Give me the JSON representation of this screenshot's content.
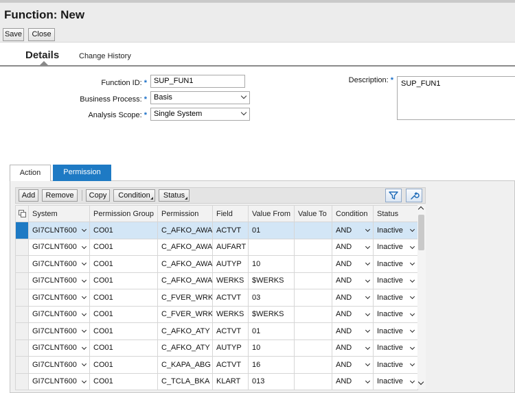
{
  "header": {
    "title": "Function: New",
    "save_label": "Save",
    "close_label": "Close"
  },
  "tabs": {
    "details": "Details",
    "change_history": "Change History"
  },
  "form": {
    "function_id_label": "Function ID:",
    "function_id_value": "SUP_FUN1",
    "business_process_label": "Business Process:",
    "business_process_value": "Basis",
    "analysis_scope_label": "Analysis Scope:",
    "analysis_scope_value": "Single System",
    "description_label": "Description:",
    "description_value": "SUP_FUN1",
    "required_marker": "*"
  },
  "subtabs": {
    "action": "Action",
    "permission": "Permission"
  },
  "toolbar": {
    "add": "Add",
    "remove": "Remove",
    "copy": "Copy",
    "condition": "Condition",
    "status": "Status"
  },
  "table": {
    "columns": [
      "System",
      "Permission Group",
      "Permission",
      "Field",
      "Value From",
      "Value To",
      "Condition",
      "Status"
    ],
    "rows": [
      [
        "GI7CLNT600",
        "CO01",
        "C_AFKO_AWA",
        "ACTVT",
        "01",
        "",
        "AND",
        "Inactive"
      ],
      [
        "GI7CLNT600",
        "CO01",
        "C_AFKO_AWA",
        "AUFART",
        "",
        "",
        "AND",
        "Inactive"
      ],
      [
        "GI7CLNT600",
        "CO01",
        "C_AFKO_AWA",
        "AUTYP",
        "10",
        "",
        "AND",
        "Inactive"
      ],
      [
        "GI7CLNT600",
        "CO01",
        "C_AFKO_AWA",
        "WERKS",
        "$WERKS",
        "",
        "AND",
        "Inactive"
      ],
      [
        "GI7CLNT600",
        "CO01",
        "C_FVER_WRK",
        "ACTVT",
        "03",
        "",
        "AND",
        "Inactive"
      ],
      [
        "GI7CLNT600",
        "CO01",
        "C_FVER_WRK",
        "WERKS",
        "$WERKS",
        "",
        "AND",
        "Inactive"
      ],
      [
        "GI7CLNT600",
        "CO01",
        "C_AFKO_ATY",
        "ACTVT",
        "01",
        "",
        "AND",
        "Inactive"
      ],
      [
        "GI7CLNT600",
        "CO01",
        "C_AFKO_ATY",
        "AUTYP",
        "10",
        "",
        "AND",
        "Inactive"
      ],
      [
        "GI7CLNT600",
        "CO01",
        "C_KAPA_ABG",
        "ACTVT",
        "16",
        "",
        "AND",
        "Inactive"
      ],
      [
        "GI7CLNT600",
        "CO01",
        "C_TCLA_BKA",
        "KLART",
        "013",
        "",
        "AND",
        "Inactive"
      ]
    ]
  },
  "colors": {
    "accent": "#1e7ac4",
    "selected_row": "#d3e6f6",
    "required": "#1a6fc7"
  },
  "icons": {
    "filter": "filter-icon",
    "settings": "wrench-icon",
    "table_settings": "table-settings-icon"
  }
}
